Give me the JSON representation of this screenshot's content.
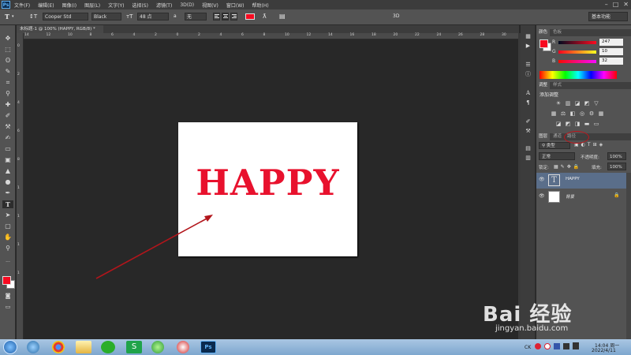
{
  "menubar": {
    "logo": "Ps",
    "items": [
      "文件(F)",
      "编辑(E)",
      "图像(I)",
      "图层(L)",
      "文字(Y)",
      "选择(S)",
      "滤镜(T)",
      "3D(D)",
      "视图(V)",
      "窗口(W)",
      "帮助(H)"
    ],
    "controls": [
      "–",
      "□",
      "✕"
    ]
  },
  "options": {
    "font_family": "Cooper Std",
    "font_style": "Black",
    "font_size": "48 点",
    "antialias_label": "a",
    "antialias": "无",
    "color": "#f70a20",
    "mode_3d": "3D",
    "workspace": "基本功能"
  },
  "document": {
    "tab_title": "未标题-1 @ 100% (HAPPY, RGB/8) *",
    "text": "HAPPY",
    "ruler_top": [
      "14",
      "12",
      "10",
      "8",
      "6",
      "4",
      "2",
      "0",
      "2",
      "4",
      "6",
      "8",
      "10",
      "12",
      "14",
      "16",
      "18",
      "20",
      "22",
      "24",
      "26",
      "28",
      "30"
    ],
    "ruler_left": [
      "0",
      "2",
      "4",
      "6",
      "8",
      "1",
      "1",
      "1",
      "1"
    ]
  },
  "color_panel": {
    "tabs": [
      "颜色",
      "色板"
    ],
    "r_label": "R",
    "r": "247",
    "g_label": "G",
    "g": "10",
    "b_label": "B",
    "b": "32"
  },
  "adjustments_panel": {
    "tabs": [
      "调整",
      "样式"
    ],
    "title": "添加调整"
  },
  "layers_panel": {
    "tabs": [
      "图层",
      "通道",
      "路径"
    ],
    "filter_kind": "类型",
    "blend_mode": "正常",
    "opacity_label": "不透明度:",
    "opacity": "100%",
    "lock_label": "锁定:",
    "fill_label": "填充:",
    "fill": "100%",
    "layers": [
      {
        "name": "HAPPY",
        "thumb": "T"
      },
      {
        "name": "背景"
      }
    ]
  },
  "taskbar": {
    "tray_lang": "CK",
    "time": "14:04 周一",
    "date": "2022/4/11"
  },
  "watermark": {
    "main": "Bai 经验",
    "sub": "jingyan.baidu.com"
  }
}
